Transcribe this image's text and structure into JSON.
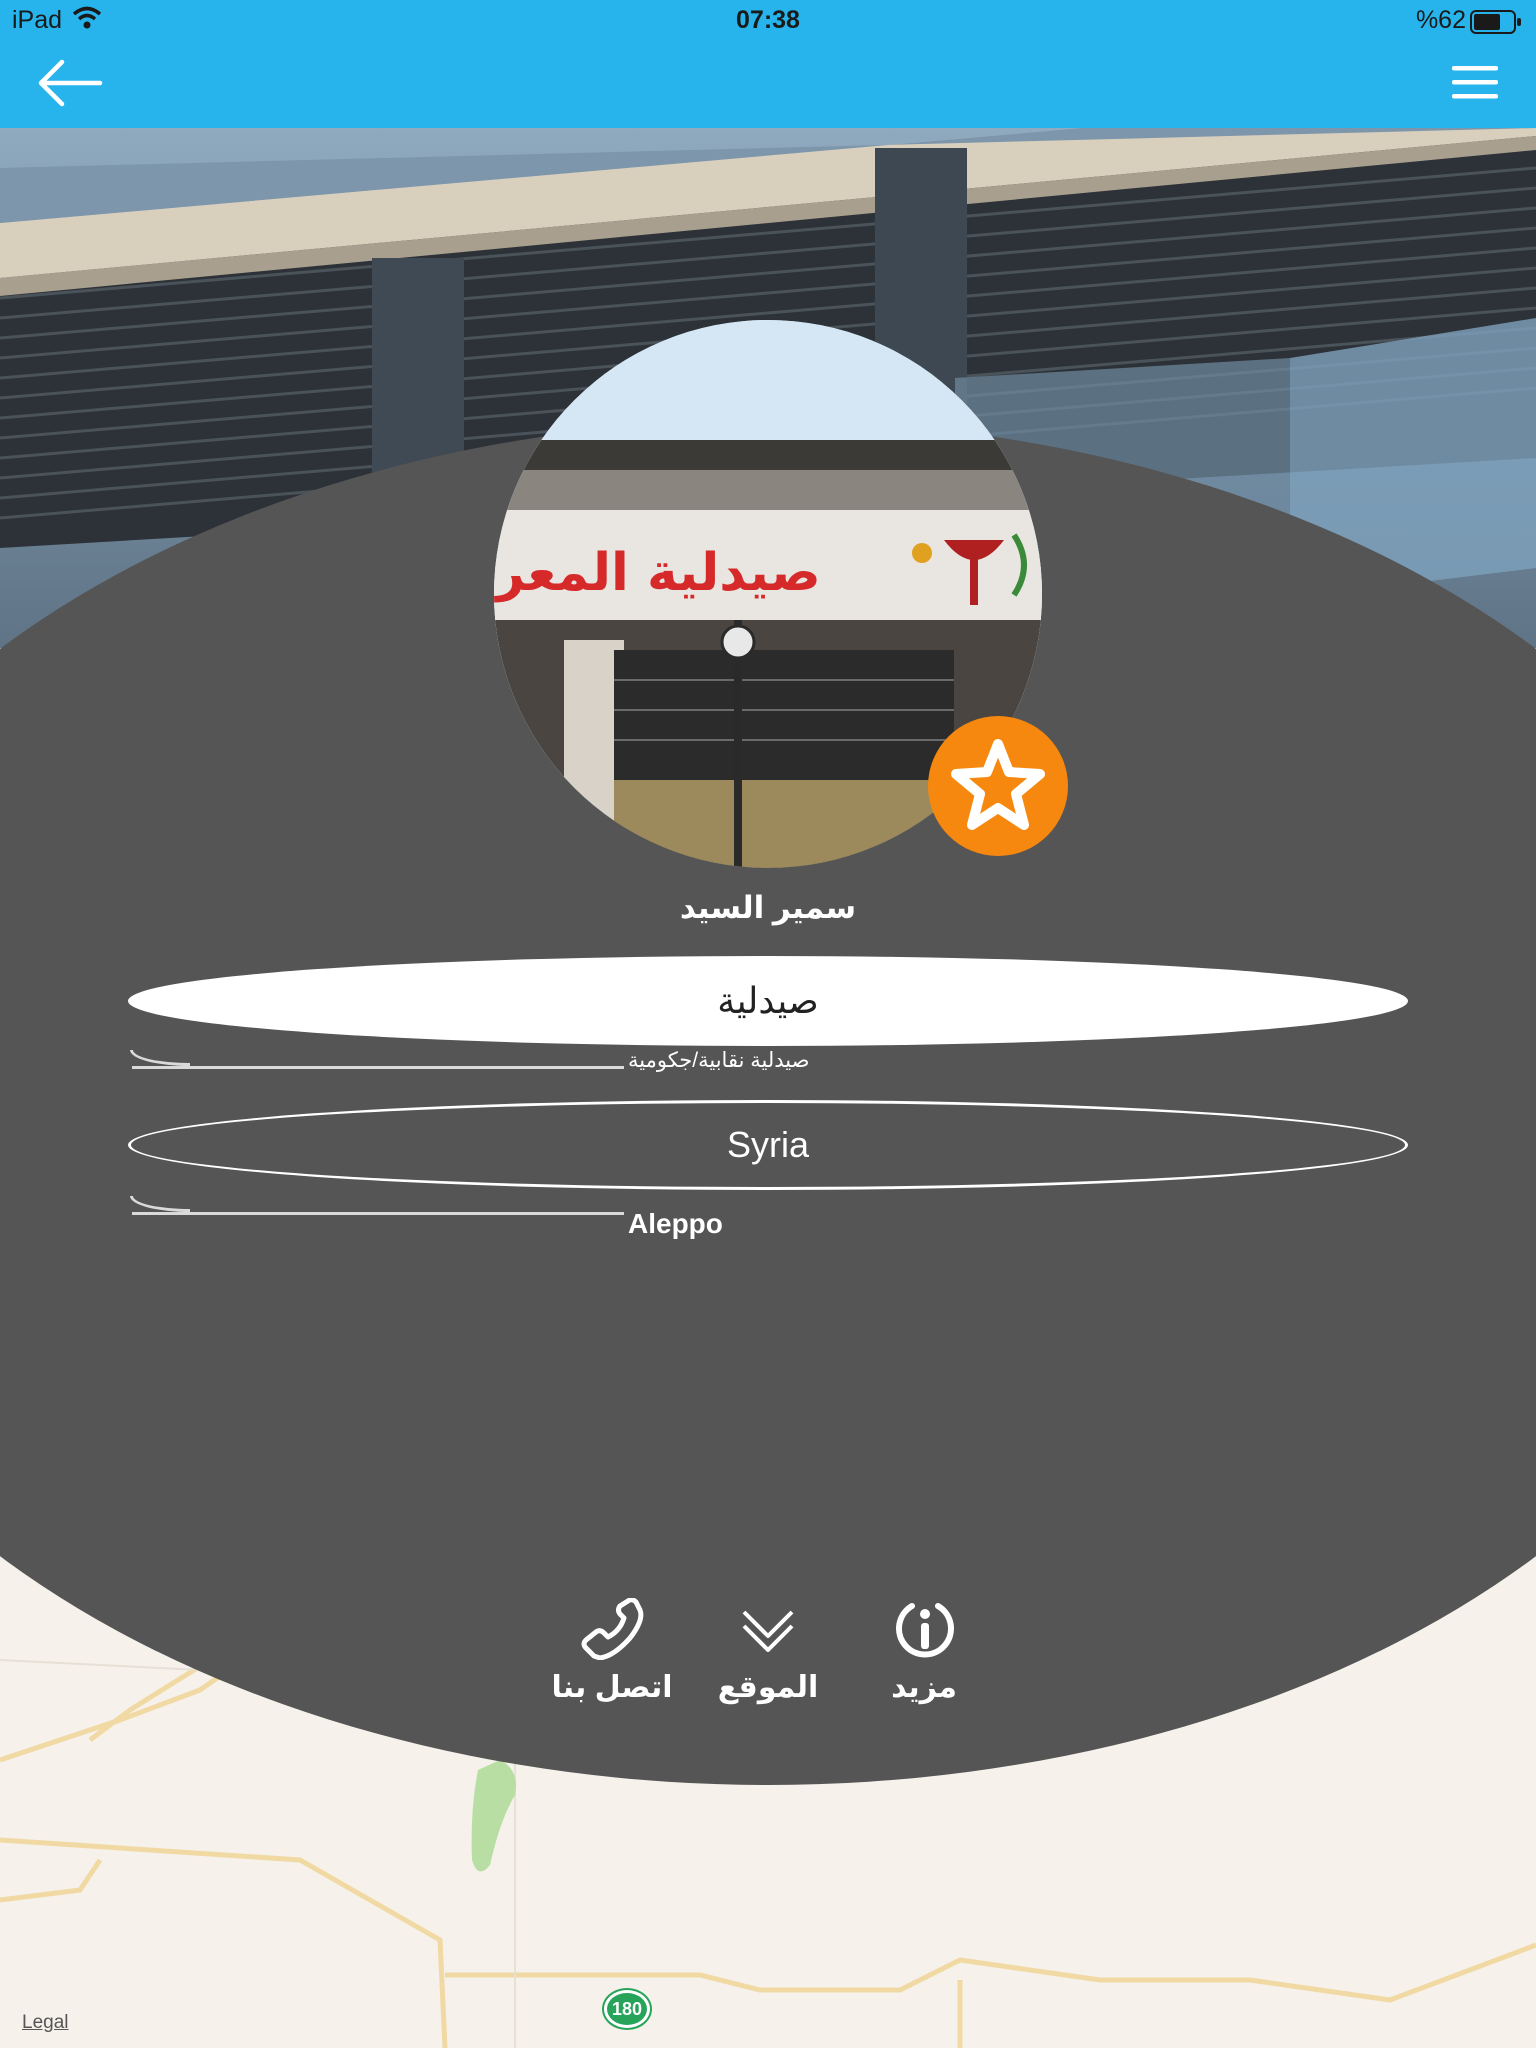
{
  "status_bar": {
    "device": "iPad",
    "time": "07:38",
    "battery": "%62"
  },
  "nav": {
    "back_icon": "arrow-left-icon",
    "menu_icon": "hamburger-menu-icon"
  },
  "profile": {
    "avatar_sign_text": "صيدلية المعري",
    "name": "سمير السيد",
    "favorite_icon": "star-icon"
  },
  "details": {
    "category": "صيدلية",
    "subcategory": "صيدلية نقابية/جكومية",
    "country": "Syria",
    "city": "Aleppo"
  },
  "actions": [
    {
      "label": "اتصل بنا",
      "icon": "phone-icon"
    },
    {
      "label": "الموقع",
      "icon": "location-chevron-icon"
    },
    {
      "label": "مزيد",
      "icon": "info-icon"
    }
  ],
  "map": {
    "legal": "Legal",
    "route_number": "180"
  },
  "colors": {
    "accent_blue": "#27b4ec",
    "panel_gray": "#555555",
    "favorite_orange": "#f7880f"
  }
}
